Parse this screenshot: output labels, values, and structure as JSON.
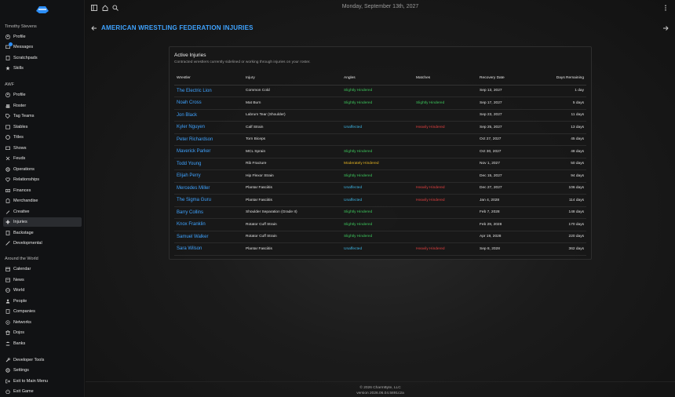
{
  "sidebar": {
    "user_name": "Timothy Stevens",
    "personal_items": [
      {
        "label": "Profile",
        "icon": "user-circle-icon"
      },
      {
        "label": "Messages",
        "icon": "message-icon"
      },
      {
        "label": "Scratchpads",
        "icon": "notepad-icon"
      },
      {
        "label": "Skills",
        "icon": "skills-icon"
      }
    ],
    "company_title": "AWF",
    "company_items": [
      {
        "label": "Profile",
        "icon": "user-circle-icon"
      },
      {
        "label": "Roster",
        "icon": "roster-icon"
      },
      {
        "label": "Tag Teams",
        "icon": "tag-icon"
      },
      {
        "label": "Stables",
        "icon": "stables-icon"
      },
      {
        "label": "Titles",
        "icon": "title-icon"
      },
      {
        "label": "Shows",
        "icon": "tv-icon"
      },
      {
        "label": "Feuds",
        "icon": "feud-icon"
      },
      {
        "label": "Operations",
        "icon": "gear-icon"
      },
      {
        "label": "Relationships",
        "icon": "relationship-icon"
      },
      {
        "label": "Finances",
        "icon": "finance-icon"
      },
      {
        "label": "Merchandise",
        "icon": "merchandise-icon"
      },
      {
        "label": "Creative",
        "icon": "creative-icon"
      },
      {
        "label": "Injuries",
        "icon": "injury-icon"
      },
      {
        "label": "Backstage",
        "icon": "backstage-icon"
      },
      {
        "label": "Developmental",
        "icon": "developmental-icon"
      }
    ],
    "world_title": "Around the World",
    "world_items": [
      {
        "label": "Calendar",
        "icon": "calendar-icon"
      },
      {
        "label": "News",
        "icon": "news-icon"
      },
      {
        "label": "World",
        "icon": "globe-icon"
      },
      {
        "label": "People",
        "icon": "people-icon"
      },
      {
        "label": "Companies",
        "icon": "company-icon"
      },
      {
        "label": "Networks",
        "icon": "network-icon"
      },
      {
        "label": "Dojos",
        "icon": "dojo-icon"
      },
      {
        "label": "Banks",
        "icon": "bank-icon"
      }
    ],
    "bottom_items": [
      {
        "label": "Developer Tools",
        "icon": "wrench-icon"
      },
      {
        "label": "Settings",
        "icon": "gear-icon"
      },
      {
        "label": "Exit to Main Menu",
        "icon": "exit-icon"
      },
      {
        "label": "Exit Game",
        "icon": "power-icon"
      }
    ]
  },
  "topbar": {
    "date": "Monday, September 13th, 2027"
  },
  "page": {
    "title": "AMERICAN WRESTLING FEDERATION INJURIES"
  },
  "card": {
    "title": "Active Injuries",
    "subtitle": "Contracted wrestlers currently sidelined or working through injuries on your roster."
  },
  "table": {
    "headers": [
      "Wrestler",
      "Injury",
      "Angles",
      "Matches",
      "Recovery Date",
      "Days Remaining"
    ],
    "rows": [
      {
        "wrestler": "The Electric Lion",
        "injury": "Common Cold",
        "angles": "Slightly Hindered",
        "matches": "",
        "recovery": "Sep 13, 2027",
        "days": "1 day"
      },
      {
        "wrestler": "Noah Cross",
        "injury": "Mat Burn",
        "angles": "Slightly Hindered",
        "matches": "Slightly Hindered",
        "recovery": "Sep 17, 2027",
        "days": "5 days"
      },
      {
        "wrestler": "Jon Black",
        "injury": "Labrum Tear (Shoulder)",
        "angles": "",
        "matches": "",
        "recovery": "Sep 23, 2027",
        "days": "11 days"
      },
      {
        "wrestler": "Kyler Nguyen",
        "injury": "Calf Strain",
        "angles": "Unaffected",
        "matches": "Heavily Hindered",
        "recovery": "Sep 25, 2027",
        "days": "13 days"
      },
      {
        "wrestler": "Peter Richardson",
        "injury": "Torn Biceps",
        "angles": "",
        "matches": "",
        "recovery": "Oct 27, 2027",
        "days": "45 days"
      },
      {
        "wrestler": "Maverick Parker",
        "injury": "MCL Sprain",
        "angles": "Slightly Hindered",
        "matches": "",
        "recovery": "Oct 30, 2027",
        "days": "48 days"
      },
      {
        "wrestler": "Todd Young",
        "injury": "Rib Fracture",
        "angles": "Moderately Hindered",
        "matches": "",
        "recovery": "Nov 1, 2027",
        "days": "50 days"
      },
      {
        "wrestler": "Elijah Perry",
        "injury": "Hip Flexor Strain",
        "angles": "Slightly Hindered",
        "matches": "",
        "recovery": "Dec 15, 2027",
        "days": "94 days"
      },
      {
        "wrestler": "Mercedes Miller",
        "injury": "Plantar Fasciitis",
        "angles": "Unaffected",
        "matches": "Heavily Hindered",
        "recovery": "Dec 27, 2027",
        "days": "106 days"
      },
      {
        "wrestler": "The Sigma Guru",
        "injury": "Plantar Fasciitis",
        "angles": "Unaffected",
        "matches": "Heavily Hindered",
        "recovery": "Jan 4, 2028",
        "days": "114 days"
      },
      {
        "wrestler": "Barry Collins",
        "injury": "Shoulder Separation (Grade II)",
        "angles": "Slightly Hindered",
        "matches": "",
        "recovery": "Feb 7, 2028",
        "days": "148 days"
      },
      {
        "wrestler": "Knox Franklin",
        "injury": "Rotator Cuff Strain",
        "angles": "Slightly Hindered",
        "matches": "",
        "recovery": "Feb 29, 2028",
        "days": "170 days"
      },
      {
        "wrestler": "Samuel Walker",
        "injury": "Rotator Cuff Strain",
        "angles": "Slightly Hindered",
        "matches": "",
        "recovery": "Apr 19, 2028",
        "days": "220 days"
      },
      {
        "wrestler": "Sara Wilson",
        "injury": "Plantar Fasciitis",
        "angles": "Unaffected",
        "matches": "Heavily Hindered",
        "recovery": "Sep 8, 2028",
        "days": "362 days"
      }
    ]
  },
  "footer": {
    "copyright": "© 2026 CharmByte, LLC",
    "version": "version 2026.06.04.5891c2a"
  },
  "colors": {
    "accent": "#3fa3ff",
    "slightly": "#3cc35a",
    "unaffected": "#3db6e6",
    "moderately": "#e6b422",
    "heavily": "#e04040"
  }
}
